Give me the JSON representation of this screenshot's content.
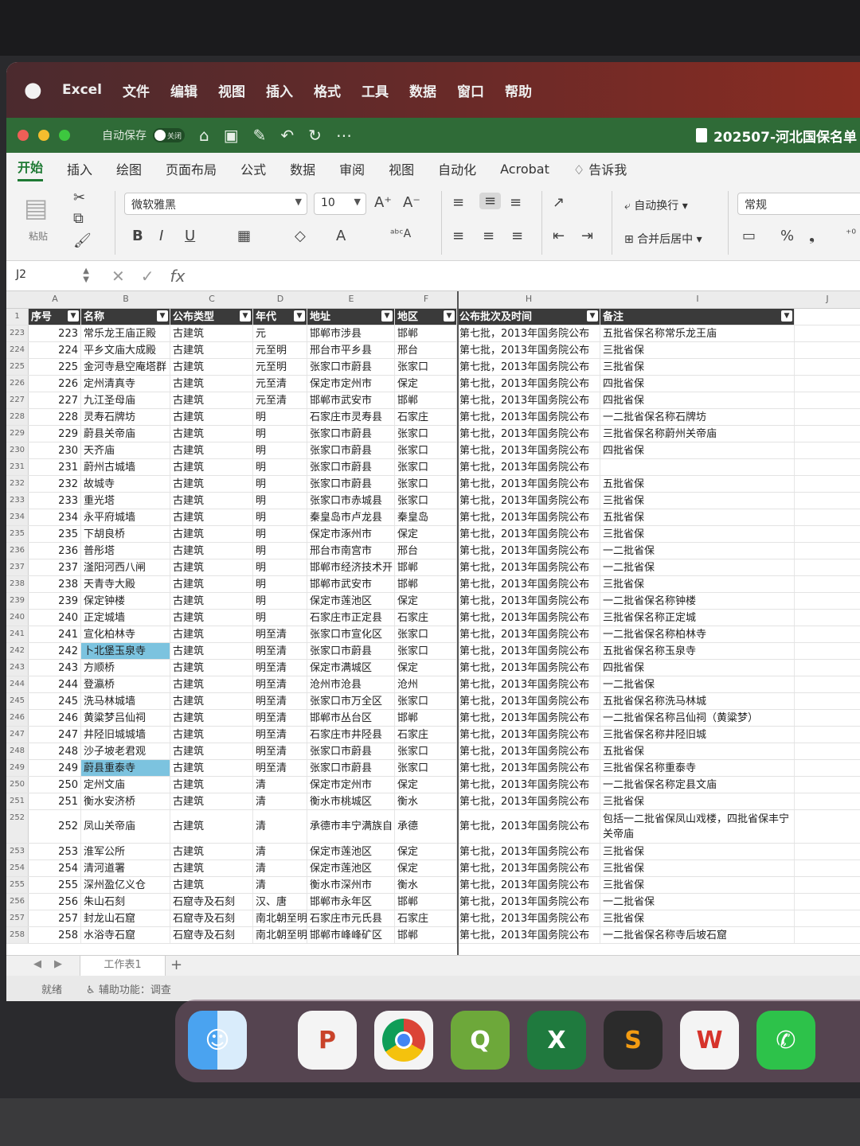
{
  "menubar": {
    "items": [
      "Excel",
      "文件",
      "编辑",
      "视图",
      "插入",
      "格式",
      "工具",
      "数据",
      "窗口",
      "帮助"
    ]
  },
  "titlebar": {
    "autosave_label": "自动保存",
    "toggle_state": "关闭",
    "doc_title": "202507-河北国保名单"
  },
  "ribbon_tabs": [
    "开始",
    "插入",
    "绘图",
    "页面布局",
    "公式",
    "数据",
    "审阅",
    "视图",
    "自动化",
    "Acrobat",
    "告诉我"
  ],
  "ribbon": {
    "paste_label": "粘贴",
    "font_name": "微软雅黑",
    "font_size": "10",
    "wrap_text": "自动换行",
    "merge_center": "合并后居中",
    "number_format": "常规"
  },
  "formula_bar": {
    "cell_ref": "J2",
    "fx_label": "fx",
    "value": ""
  },
  "columns": [
    "A",
    "B",
    "C",
    "D",
    "E",
    "F",
    "H",
    "I",
    "J"
  ],
  "header": [
    "序号",
    "名称",
    "公布类型",
    "年代",
    "地址",
    "地区",
    "公布批次及时间",
    "备注"
  ],
  "rows": [
    {
      "r": "223",
      "n": "223",
      "name": "常乐龙王庙正殿",
      "type": "古建筑",
      "era": "元",
      "addr": "邯郸市涉县",
      "area": "邯郸",
      "batch": "第七批，2013年国务院公布",
      "note": "五批省保名称常乐龙王庙"
    },
    {
      "r": "224",
      "n": "224",
      "name": "平乡文庙大成殿",
      "type": "古建筑",
      "era": "元至明",
      "addr": "邢台市平乡县",
      "area": "邢台",
      "batch": "第七批，2013年国务院公布",
      "note": "三批省保"
    },
    {
      "r": "225",
      "n": "225",
      "name": "金河寺悬空庵塔群",
      "type": "古建筑",
      "era": "元至明",
      "addr": "张家口市蔚县",
      "area": "张家口",
      "batch": "第七批，2013年国务院公布",
      "note": "三批省保"
    },
    {
      "r": "226",
      "n": "226",
      "name": "定州清真寺",
      "type": "古建筑",
      "era": "元至清",
      "addr": "保定市定州市",
      "area": "保定",
      "batch": "第七批，2013年国务院公布",
      "note": "四批省保"
    },
    {
      "r": "227",
      "n": "227",
      "name": "九江圣母庙",
      "type": "古建筑",
      "era": "元至清",
      "addr": "邯郸市武安市",
      "area": "邯郸",
      "batch": "第七批，2013年国务院公布",
      "note": "四批省保"
    },
    {
      "r": "228",
      "n": "228",
      "name": "灵寿石牌坊",
      "type": "古建筑",
      "era": "明",
      "addr": "石家庄市灵寿县",
      "area": "石家庄",
      "batch": "第七批，2013年国务院公布",
      "note": "一二批省保名称石牌坊"
    },
    {
      "r": "229",
      "n": "229",
      "name": "蔚县关帝庙",
      "type": "古建筑",
      "era": "明",
      "addr": "张家口市蔚县",
      "area": "张家口",
      "batch": "第七批，2013年国务院公布",
      "note": "三批省保名称蔚州关帝庙"
    },
    {
      "r": "230",
      "n": "230",
      "name": "天齐庙",
      "type": "古建筑",
      "era": "明",
      "addr": "张家口市蔚县",
      "area": "张家口",
      "batch": "第七批，2013年国务院公布",
      "note": "四批省保"
    },
    {
      "r": "231",
      "n": "231",
      "name": "蔚州古城墙",
      "type": "古建筑",
      "era": "明",
      "addr": "张家口市蔚县",
      "area": "张家口",
      "batch": "第七批，2013年国务院公布",
      "note": ""
    },
    {
      "r": "232",
      "n": "232",
      "name": "故城寺",
      "type": "古建筑",
      "era": "明",
      "addr": "张家口市蔚县",
      "area": "张家口",
      "batch": "第七批，2013年国务院公布",
      "note": "五批省保"
    },
    {
      "r": "233",
      "n": "233",
      "name": "重光塔",
      "type": "古建筑",
      "era": "明",
      "addr": "张家口市赤城县",
      "area": "张家口",
      "batch": "第七批，2013年国务院公布",
      "note": "三批省保"
    },
    {
      "r": "234",
      "n": "234",
      "name": "永平府城墙",
      "type": "古建筑",
      "era": "明",
      "addr": "秦皇岛市卢龙县",
      "area": "秦皇岛",
      "batch": "第七批，2013年国务院公布",
      "note": "五批省保"
    },
    {
      "r": "235",
      "n": "235",
      "name": "下胡良桥",
      "type": "古建筑",
      "era": "明",
      "addr": "保定市涿州市",
      "area": "保定",
      "batch": "第七批，2013年国务院公布",
      "note": "三批省保"
    },
    {
      "r": "236",
      "n": "236",
      "name": "普彤塔",
      "type": "古建筑",
      "era": "明",
      "addr": "邢台市南宫市",
      "area": "邢台",
      "batch": "第七批，2013年国务院公布",
      "note": "一二批省保"
    },
    {
      "r": "237",
      "n": "237",
      "name": "滏阳河西八闸",
      "type": "古建筑",
      "era": "明",
      "addr": "邯郸市经济技术开",
      "area": "邯郸",
      "batch": "第七批，2013年国务院公布",
      "note": "一二批省保"
    },
    {
      "r": "238",
      "n": "238",
      "name": "天青寺大殿",
      "type": "古建筑",
      "era": "明",
      "addr": "邯郸市武安市",
      "area": "邯郸",
      "batch": "第七批，2013年国务院公布",
      "note": "三批省保"
    },
    {
      "r": "239",
      "n": "239",
      "name": "保定钟楼",
      "type": "古建筑",
      "era": "明",
      "addr": "保定市莲池区",
      "area": "保定",
      "batch": "第七批，2013年国务院公布",
      "note": "一二批省保名称钟楼"
    },
    {
      "r": "240",
      "n": "240",
      "name": "正定城墙",
      "type": "古建筑",
      "era": "明",
      "addr": "石家庄市正定县",
      "area": "石家庄",
      "batch": "第七批，2013年国务院公布",
      "note": "三批省保名称正定城"
    },
    {
      "r": "241",
      "n": "241",
      "name": "宣化柏林寺",
      "type": "古建筑",
      "era": "明至清",
      "addr": "张家口市宣化区",
      "area": "张家口",
      "batch": "第七批，2013年国务院公布",
      "note": "一二批省保名称柏林寺"
    },
    {
      "r": "242",
      "n": "242",
      "name": "卜北堡玉泉寺",
      "type": "古建筑",
      "era": "明至清",
      "addr": "张家口市蔚县",
      "area": "张家口",
      "batch": "第七批，2013年国务院公布",
      "note": "五批省保名称玉泉寺",
      "sel": true
    },
    {
      "r": "243",
      "n": "243",
      "name": "方顺桥",
      "type": "古建筑",
      "era": "明至清",
      "addr": "保定市满城区",
      "area": "保定",
      "batch": "第七批，2013年国务院公布",
      "note": "四批省保"
    },
    {
      "r": "244",
      "n": "244",
      "name": "登瀛桥",
      "type": "古建筑",
      "era": "明至清",
      "addr": "沧州市沧县",
      "area": "沧州",
      "batch": "第七批，2013年国务院公布",
      "note": "一二批省保"
    },
    {
      "r": "245",
      "n": "245",
      "name": "洗马林城墙",
      "type": "古建筑",
      "era": "明至清",
      "addr": "张家口市万全区",
      "area": "张家口",
      "batch": "第七批，2013年国务院公布",
      "note": "五批省保名称洗马林城"
    },
    {
      "r": "246",
      "n": "246",
      "name": "黄粱梦吕仙祠",
      "type": "古建筑",
      "era": "明至清",
      "addr": "邯郸市丛台区",
      "area": "邯郸",
      "batch": "第七批，2013年国务院公布",
      "note": "一二批省保名称吕仙祠（黄粱梦）"
    },
    {
      "r": "247",
      "n": "247",
      "name": "井陉旧城城墙",
      "type": "古建筑",
      "era": "明至清",
      "addr": "石家庄市井陉县",
      "area": "石家庄",
      "batch": "第七批，2013年国务院公布",
      "note": "三批省保名称井陉旧城"
    },
    {
      "r": "248",
      "n": "248",
      "name": "沙子坡老君观",
      "type": "古建筑",
      "era": "明至清",
      "addr": "张家口市蔚县",
      "area": "张家口",
      "batch": "第七批，2013年国务院公布",
      "note": "五批省保"
    },
    {
      "r": "249",
      "n": "249",
      "name": "蔚县重泰寺",
      "type": "古建筑",
      "era": "明至清",
      "addr": "张家口市蔚县",
      "area": "张家口",
      "batch": "第七批，2013年国务院公布",
      "note": "三批省保名称重泰寺",
      "sel": true
    },
    {
      "r": "250",
      "n": "250",
      "name": "定州文庙",
      "type": "古建筑",
      "era": "清",
      "addr": "保定市定州市",
      "area": "保定",
      "batch": "第七批，2013年国务院公布",
      "note": "一二批省保名称定县文庙"
    },
    {
      "r": "251",
      "n": "251",
      "name": "衡水安济桥",
      "type": "古建筑",
      "era": "清",
      "addr": "衡水市桃城区",
      "area": "衡水",
      "batch": "第七批，2013年国务院公布",
      "note": "三批省保"
    },
    {
      "r": "252",
      "n": "252",
      "name": "凤山关帝庙",
      "type": "古建筑",
      "era": "清",
      "addr": "承德市丰宁满族自",
      "area": "承德",
      "batch": "第七批，2013年国务院公布",
      "note": "包括一二批省保凤山戏楼，四批省保丰宁关帝庙",
      "tall": true
    },
    {
      "r": "253",
      "n": "253",
      "name": "淮军公所",
      "type": "古建筑",
      "era": "清",
      "addr": "保定市莲池区",
      "area": "保定",
      "batch": "第七批，2013年国务院公布",
      "note": "三批省保"
    },
    {
      "r": "254",
      "n": "254",
      "name": "清河道署",
      "type": "古建筑",
      "era": "清",
      "addr": "保定市莲池区",
      "area": "保定",
      "batch": "第七批，2013年国务院公布",
      "note": "三批省保"
    },
    {
      "r": "255",
      "n": "255",
      "name": "深州盈亿义仓",
      "type": "古建筑",
      "era": "清",
      "addr": "衡水市深州市",
      "area": "衡水",
      "batch": "第七批，2013年国务院公布",
      "note": "三批省保"
    },
    {
      "r": "256",
      "n": "256",
      "name": "朱山石刻",
      "type": "石窟寺及石刻",
      "era": "汉、唐",
      "addr": "邯郸市永年区",
      "area": "邯郸",
      "batch": "第七批，2013年国务院公布",
      "note": "一二批省保"
    },
    {
      "r": "257",
      "n": "257",
      "name": "封龙山石窟",
      "type": "石窟寺及石刻",
      "era": "南北朝至明",
      "addr": "石家庄市元氏县",
      "area": "石家庄",
      "batch": "第七批，2013年国务院公布",
      "note": "三批省保"
    },
    {
      "r": "258",
      "n": "258",
      "name": "水浴寺石窟",
      "type": "石窟寺及石刻",
      "era": "南北朝至明",
      "addr": "邯郸市峰峰矿区",
      "area": "邯郸",
      "batch": "第七批，2013年国务院公布",
      "note": "一二批省保名称寺后坡石窟"
    }
  ],
  "sheet": {
    "tab_name": "工作表1",
    "add": "+"
  },
  "status": {
    "ready": "就绪",
    "accessibility": "辅助功能：调查"
  },
  "dock": [
    "Finder",
    "PowerPoint",
    "Chrome",
    "QGIS",
    "Excel",
    "Sublime Text",
    "WPS",
    "WeChat"
  ]
}
